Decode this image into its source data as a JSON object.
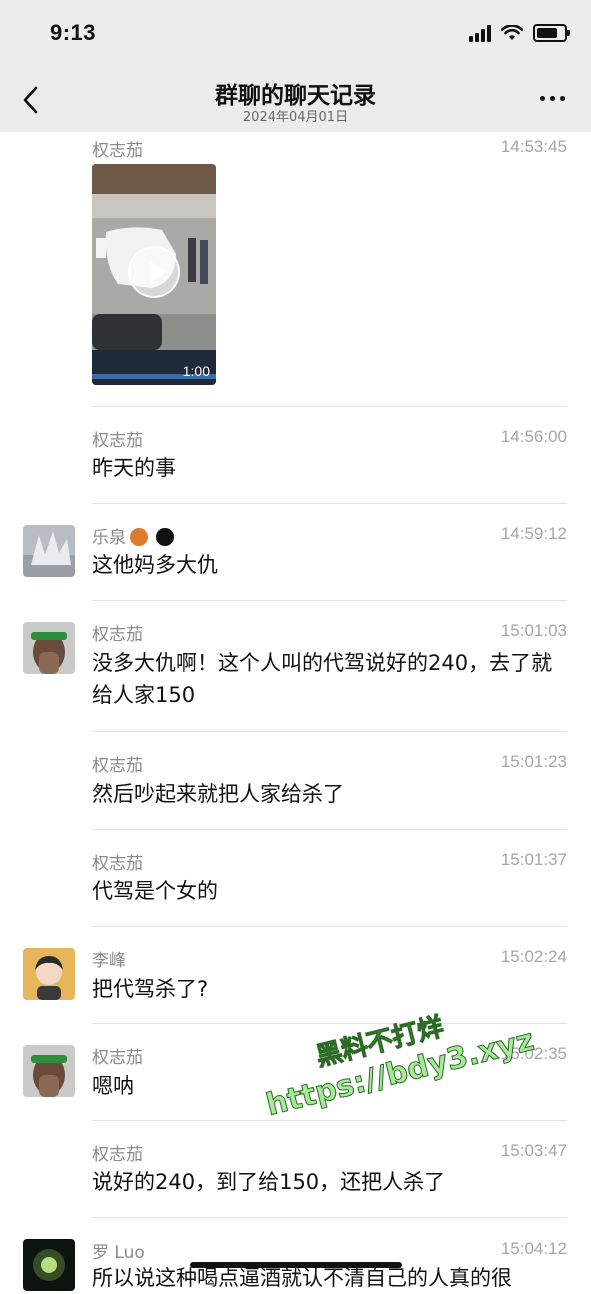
{
  "status": {
    "time": "9:13"
  },
  "nav": {
    "title": "群聊的聊天记录",
    "date": "2024年04月01日"
  },
  "video": {
    "duration": "1:00"
  },
  "messages": [
    {
      "sender": "权志茄",
      "time": "14:53:45"
    },
    {
      "sender": "权志茄",
      "time": "14:56:00",
      "text": "昨天的事"
    },
    {
      "sender": "乐泉",
      "time": "14:59:12",
      "text": "这他妈多大仇"
    },
    {
      "sender": "权志茄",
      "time": "15:01:03",
      "text": "没多大仇啊！这个人叫的代驾说好的240，去了就给人家150"
    },
    {
      "sender": "权志茄",
      "time": "15:01:23",
      "text": "然后吵起来就把人家给杀了"
    },
    {
      "sender": "权志茄",
      "time": "15:01:37",
      "text": "代驾是个女的"
    },
    {
      "sender": "李峰",
      "time": "15:02:24",
      "text": "把代驾杀了?"
    },
    {
      "sender": "权志茄",
      "time": "15:02:35",
      "text": "嗯呐"
    },
    {
      "sender": "权志茄",
      "time": "15:03:47",
      "text": "说好的240，到了给150，还把人杀了"
    },
    {
      "sender": "罗 Luo",
      "time": "15:04:12",
      "text": "所以说这种喝点逼酒就认不清自己的人真的很"
    }
  ],
  "watermark": {
    "line1": "黑料不打烊",
    "line2": "https://bdy3.xyz"
  }
}
